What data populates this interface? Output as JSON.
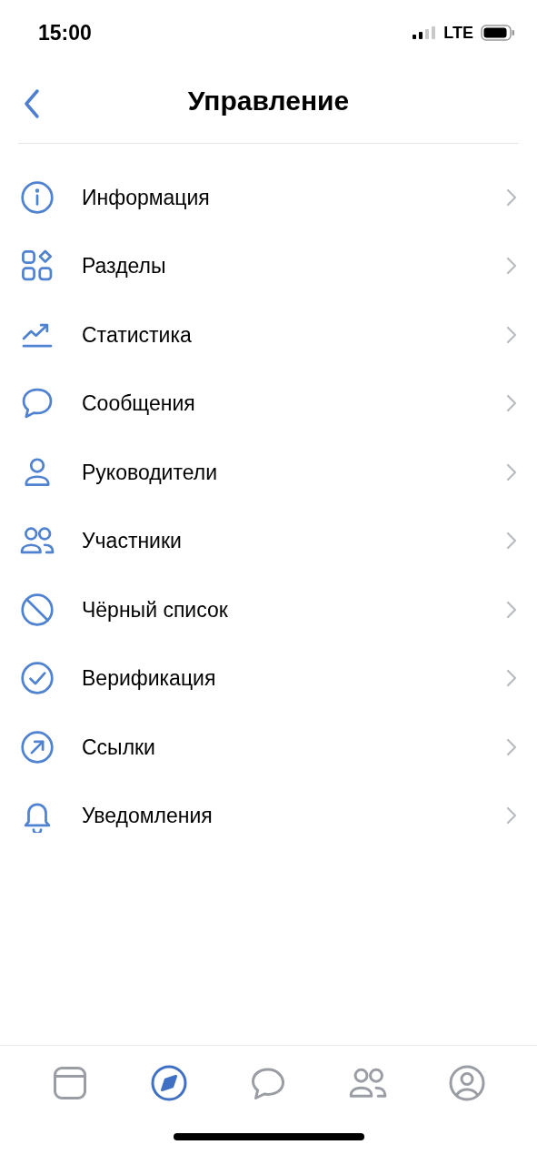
{
  "status_bar": {
    "time": "15:00",
    "network": "LTE"
  },
  "header": {
    "title": "Управление"
  },
  "menu": [
    {
      "label": "Информация"
    },
    {
      "label": "Разделы"
    },
    {
      "label": "Статистика"
    },
    {
      "label": "Сообщения"
    },
    {
      "label": "Руководители"
    },
    {
      "label": "Участники"
    },
    {
      "label": "Чёрный список"
    },
    {
      "label": "Верификация"
    },
    {
      "label": "Ссылки"
    },
    {
      "label": "Уведомления"
    }
  ],
  "tab_bar": [
    {
      "selected": false
    },
    {
      "selected": true
    },
    {
      "selected": false
    },
    {
      "selected": false
    },
    {
      "selected": false
    }
  ]
}
